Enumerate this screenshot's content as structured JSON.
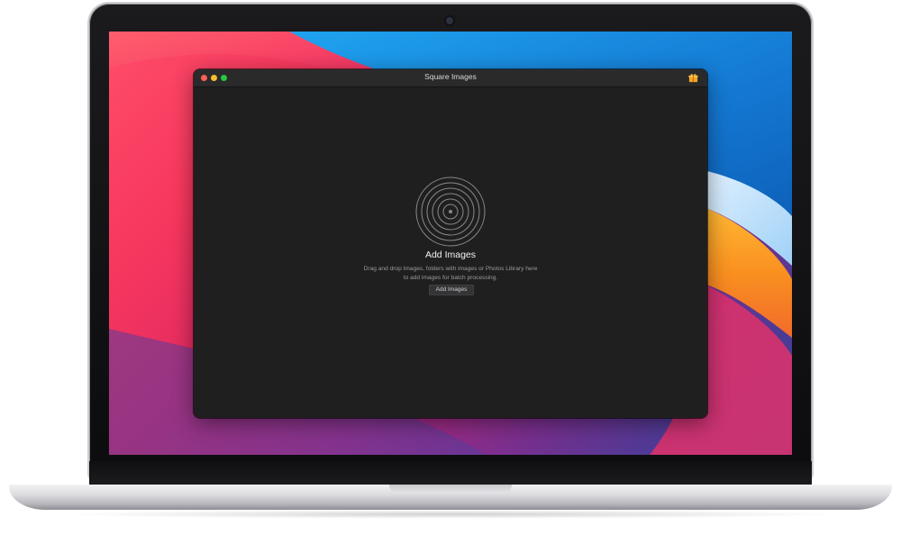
{
  "window": {
    "title": "Square Images"
  },
  "icons": {
    "close": "close-icon",
    "minimize": "minimize-icon",
    "maximize": "maximize-icon",
    "gift": "gift-icon",
    "drop_target": "concentric-rings-icon"
  },
  "main": {
    "heading": "Add Images",
    "description_line1": "Drag and drop Images, folders with images or Photos Library here",
    "description_line2": "to add images for batch processing.",
    "add_button_label": "Add Images"
  },
  "colors": {
    "window_bg": "#1f1f1f",
    "traffic_close": "#fe5f57",
    "traffic_minimize": "#febc2e",
    "traffic_maximize": "#28c840",
    "gift_accent": "#f5a623"
  }
}
